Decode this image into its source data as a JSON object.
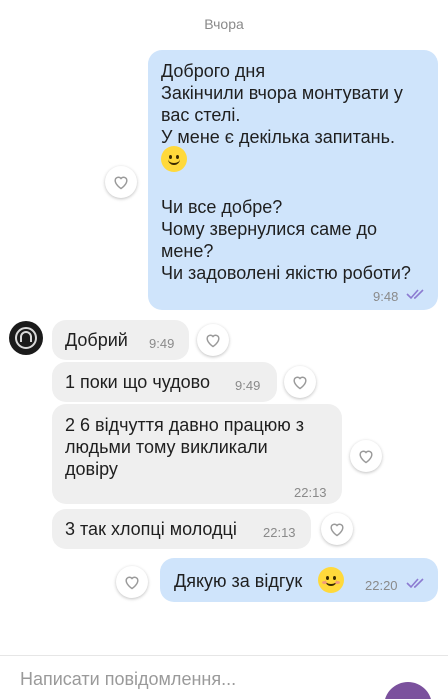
{
  "date_separator": "Вчора",
  "messages": [
    {
      "direction": "outgoing",
      "lines_1": "Доброго дня\nЗакінчили вчора монтувати у вас стелі.\nУ мене є декілька запитань.",
      "emoji": "slightly-smiling-face",
      "lines_2": "Чи все добре?\nЧому звернулися саме до мене?\nЧи задоволені якістю роботи?",
      "time": "9:48"
    },
    {
      "direction": "incoming",
      "text": "Добрий",
      "time": "9:49"
    },
    {
      "direction": "incoming",
      "text": "1 поки що чудово",
      "time": "9:49"
    },
    {
      "direction": "incoming",
      "text": "2 6 відчуття давно працюю з\nлюдьми тому викликали\nдовіру",
      "time": "22:13"
    },
    {
      "direction": "incoming",
      "text": "3 так хлопці молодці",
      "time": "22:13"
    },
    {
      "direction": "outgoing",
      "text": "Дякую за відгук",
      "emoji": "smiling-face-blush",
      "time": "22:20"
    }
  ],
  "composer": {
    "placeholder": "Написати повідомлення..."
  },
  "colors": {
    "outgoing_bubble": "#cfe4fb",
    "incoming_bubble": "#efefef",
    "read_ticks": "#8c7bd1",
    "send_button": "#7b519d"
  }
}
